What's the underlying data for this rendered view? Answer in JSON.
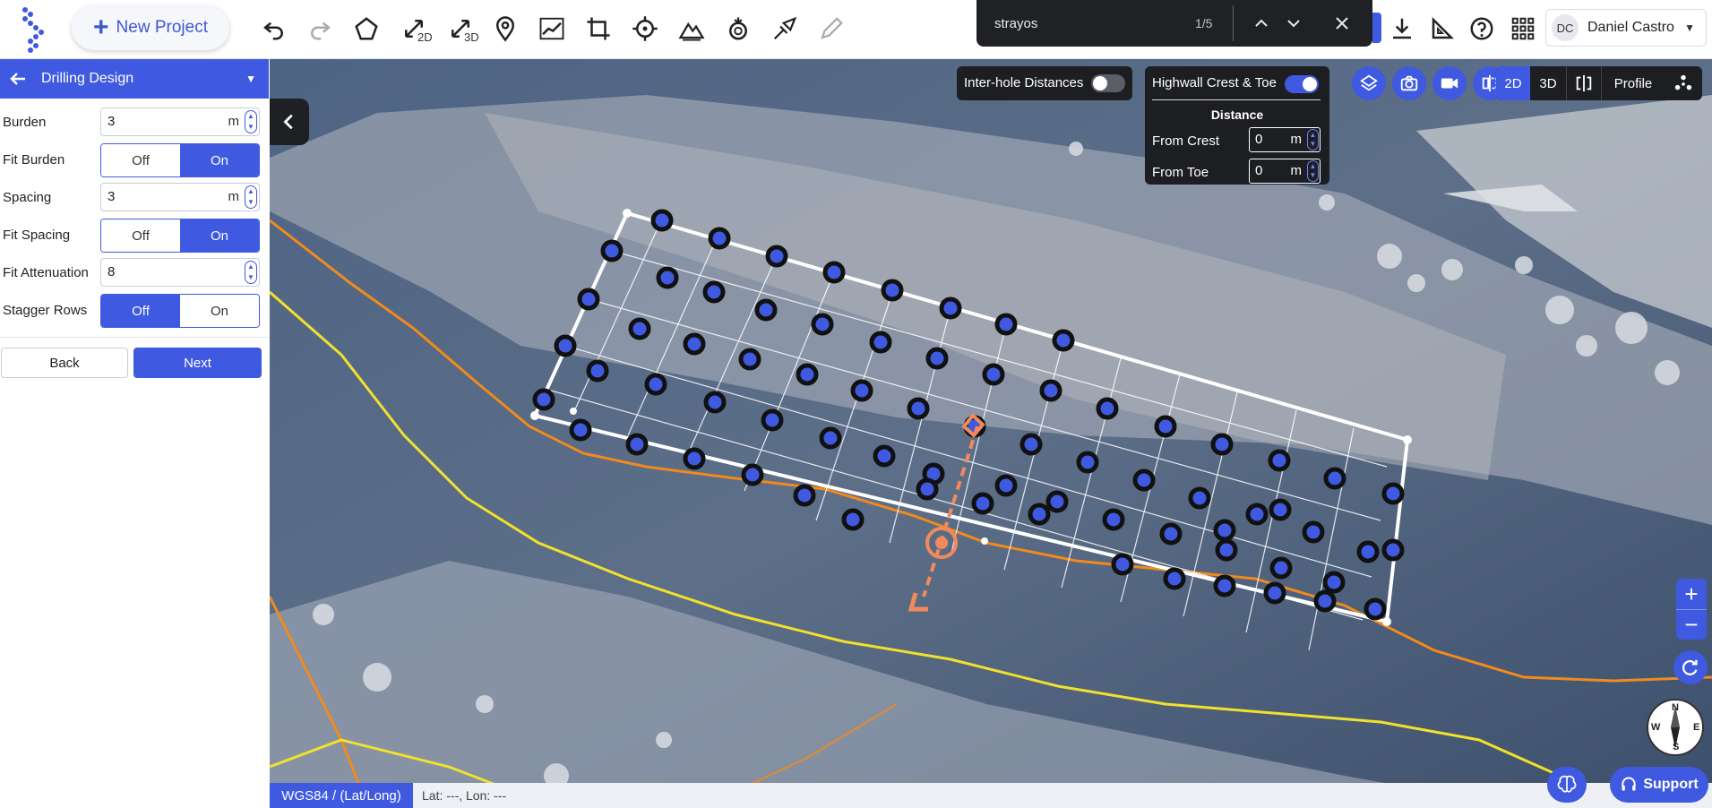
{
  "header": {
    "new_project_label": "New Project",
    "tool_2d_sub": "2D",
    "tool_3d_sub": "3D"
  },
  "find_bar": {
    "query": "strayos",
    "count": "1/5"
  },
  "user": {
    "initials": "DC",
    "name": "Daniel Castro"
  },
  "panel": {
    "title": "Drilling Design",
    "fields": {
      "burden": {
        "label": "Burden",
        "value": "3",
        "unit": "m"
      },
      "fit_burden": {
        "label": "Fit Burden",
        "off": "Off",
        "on": "On",
        "selected": "On"
      },
      "spacing": {
        "label": "Spacing",
        "value": "3",
        "unit": "m"
      },
      "fit_spacing": {
        "label": "Fit Spacing",
        "off": "Off",
        "on": "On",
        "selected": "On"
      },
      "fit_attenuation": {
        "label": "Fit Attenuation",
        "value": "8"
      },
      "stagger_rows": {
        "label": "Stagger Rows",
        "off": "Off",
        "on": "On",
        "selected": "Off"
      }
    },
    "back_label": "Back",
    "next_label": "Next"
  },
  "map": {
    "inter_hole_label": "Inter-hole Distances",
    "inter_hole_on": false,
    "highwall_label": "Highwall Crest & Toe",
    "highwall_on": true,
    "distance_heading": "Distance",
    "from_crest_label": "From Crest",
    "from_crest_value": "0",
    "from_crest_unit": "m",
    "from_toe_label": "From Toe",
    "from_toe_value": "0",
    "from_toe_unit": "m",
    "view_modes": {
      "mode_2d": "2D",
      "mode_3d": "3D",
      "profile": "Profile"
    },
    "zoom_in": "+",
    "zoom_out": "−",
    "compass": {
      "n": "N",
      "s": "S",
      "e": "E",
      "w": "W"
    }
  },
  "status": {
    "crs": "WGS84 / (Lat/Long)",
    "coords": "Lat: ---, Lon: ---"
  },
  "support_label": "Support",
  "colors": {
    "accent": "#3f5ae0",
    "dark_panel": "#1d1e22",
    "crest_line": "#f28a1c",
    "toe_line": "#f2e12c",
    "direction_arrow": "#f08a5d"
  }
}
